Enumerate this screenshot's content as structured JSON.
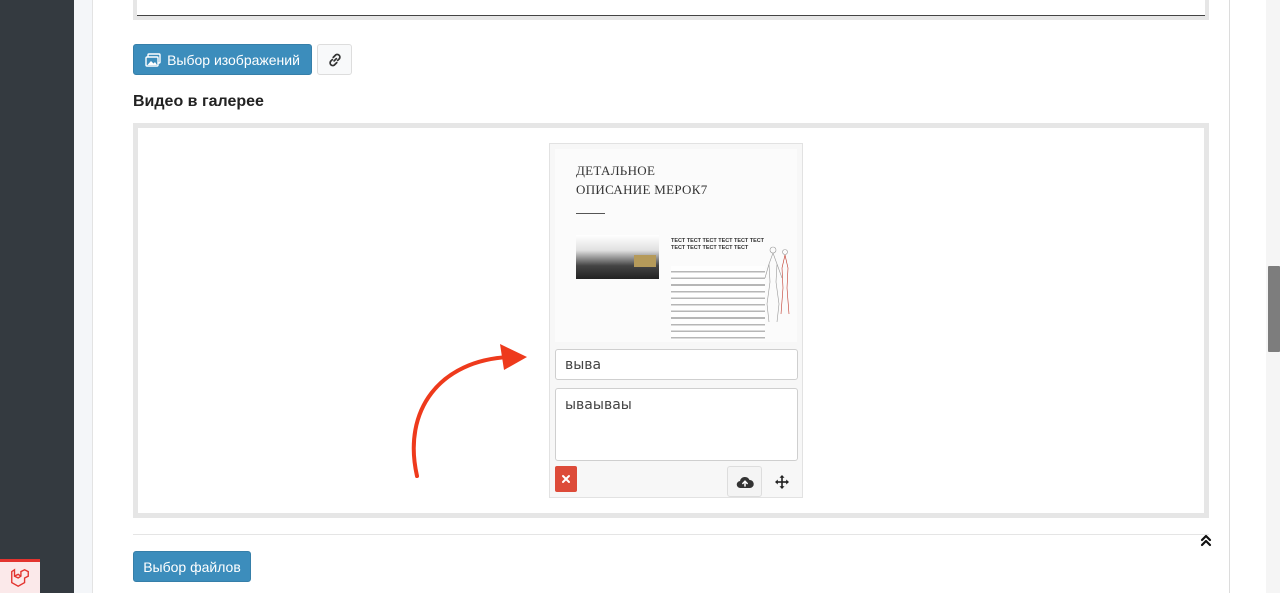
{
  "toolbar": {
    "select_images_label": "Выбор изображений",
    "select_files_label": "Выбор файлов"
  },
  "section": {
    "video_gallery_title": "Видео в галерее"
  },
  "video_item": {
    "thumbnail": {
      "title_line1": "ДЕТАЛЬНОЕ",
      "title_line2": "ОПИСАНИЕ МЕРОК7",
      "heading_text": "ТЕСТ ТЕСТ ТЕСТ ТЕСТ ТЕСТ ТЕСТ ТЕСТ ТЕСТ ТЕСТ ТЕСТ ТЕСТ"
    },
    "title_value": "выва",
    "description_value": "ываываы"
  },
  "colors": {
    "primary": "#3c8dbc",
    "danger": "#dd4b39",
    "annotation_arrow": "#ee3a1c",
    "sidebar": "#343a40"
  },
  "icons": {
    "images": "images-icon",
    "link": "link-icon",
    "delete": "close-icon",
    "upload": "cloud-upload-icon",
    "move": "arrows-move-icon",
    "scroll_top": "double-chevron-up-icon",
    "laravel": "laravel-logo-icon"
  }
}
